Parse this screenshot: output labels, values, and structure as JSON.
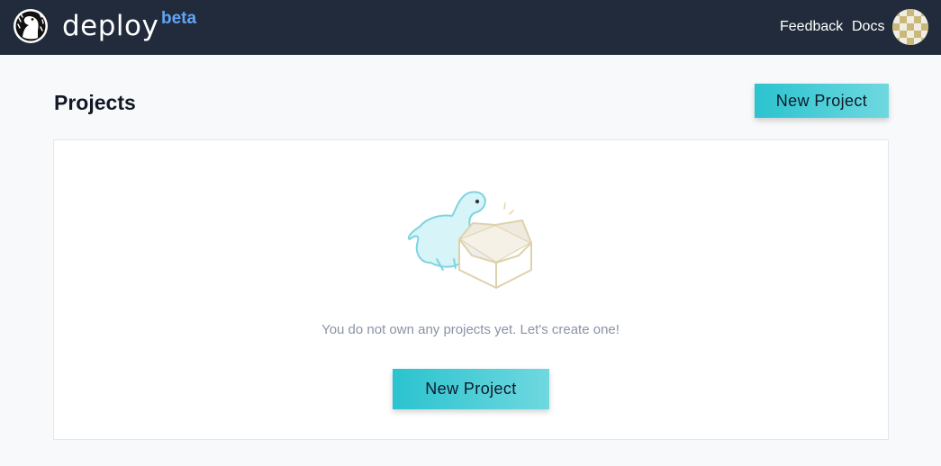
{
  "header": {
    "brand": "deploy",
    "badge": "beta",
    "nav": {
      "feedback": "Feedback",
      "docs": "Docs"
    },
    "icons": {
      "logo": "deno-dinosaur-logo-icon",
      "avatar": "user-avatar-icon"
    }
  },
  "main": {
    "title": "Projects",
    "new_project_label": "New Project",
    "empty_state": {
      "illustration": "dinosaur-with-open-box",
      "message": "You do not own any projects yet. Let's create one!",
      "cta_label": "New Project"
    }
  },
  "colors": {
    "topbar": "#212b3b",
    "beta": "#62a5f6",
    "button_start": "#2ac3cf",
    "button_end": "#6fd8df",
    "background": "#f8f9fb"
  }
}
